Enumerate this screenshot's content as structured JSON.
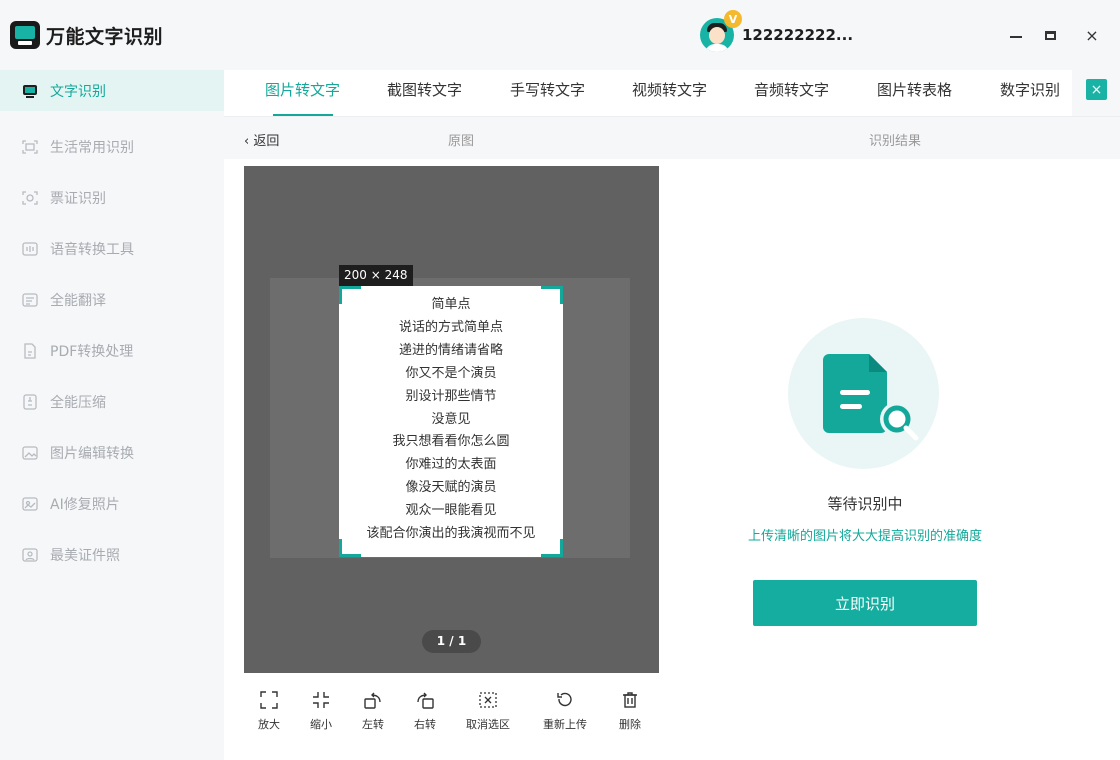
{
  "app": {
    "title": "万能文字识别"
  },
  "user": {
    "name": "122222222...",
    "vip_badge": "V"
  },
  "window": {
    "min_icon": "minimize-icon",
    "max_icon": "maximize-icon",
    "close_label": "×"
  },
  "sidebar": {
    "items": [
      {
        "label": "文字识别",
        "icon": "text-recognize-icon",
        "active": true
      },
      {
        "label": "生活常用识别",
        "icon": "life-scan-icon"
      },
      {
        "label": "票证识别",
        "icon": "ticket-scan-icon"
      },
      {
        "label": "语音转换工具",
        "icon": "voice-tool-icon"
      },
      {
        "label": "全能翻译",
        "icon": "translate-icon"
      },
      {
        "label": "PDF转换处理",
        "icon": "pdf-icon"
      },
      {
        "label": "全能压缩",
        "icon": "compress-icon"
      },
      {
        "label": "图片编辑转换",
        "icon": "image-edit-icon"
      },
      {
        "label": "AI修复照片",
        "icon": "ai-repair-icon"
      },
      {
        "label": "最美证件照",
        "icon": "id-photo-icon"
      }
    ]
  },
  "tabs": {
    "items": [
      {
        "label": "图片转文字",
        "active": true
      },
      {
        "label": "截图转文字"
      },
      {
        "label": "手写转文字"
      },
      {
        "label": "视频转文字"
      },
      {
        "label": "音频转文字"
      },
      {
        "label": "图片转表格"
      },
      {
        "label": "数字识别"
      }
    ],
    "close_label": "×"
  },
  "subheader": {
    "back": "‹ 返回",
    "original": "原图",
    "result": "识别结果"
  },
  "preview": {
    "dimensions": "200 × 248",
    "lines": [
      "简单点",
      "说话的方式简单点",
      "递进的情绪请省略",
      "你又不是个演员",
      "别设计那些情节",
      "没意见",
      "我只想看看你怎么圆",
      "你难过的太表面",
      "像没天赋的演员",
      "观众一眼能看见",
      "该配合你演出的我演视而不见"
    ],
    "pager": "1 / 1"
  },
  "toolbar": {
    "items": [
      {
        "label": "放大",
        "icon": "zoom-in-icon"
      },
      {
        "label": "缩小",
        "icon": "zoom-out-icon"
      },
      {
        "label": "左转",
        "icon": "rotate-left-icon"
      },
      {
        "label": "右转",
        "icon": "rotate-right-icon"
      },
      {
        "label": "取消选区",
        "icon": "cancel-selection-icon"
      },
      {
        "label": "重新上传",
        "icon": "reupload-icon"
      },
      {
        "label": "删除",
        "icon": "delete-icon"
      }
    ]
  },
  "result": {
    "status": "等待识别中",
    "hint": "上传清晰的图片将大大提高识别的准确度",
    "button": "立即识别",
    "illustration_icon": "document-search-icon"
  },
  "colors": {
    "accent": "#14a89a",
    "sidebar_bg": "#f6f7f9",
    "preview_bg": "#616161",
    "active_menu_bg": "#e3f4f2"
  }
}
